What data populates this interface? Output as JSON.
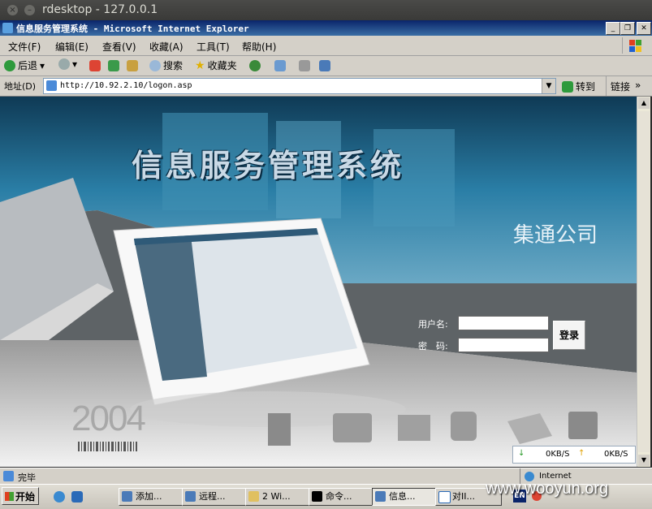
{
  "rdesktop": {
    "title": "rdesktop - 127.0.0.1",
    "close": "×",
    "minimize": "–"
  },
  "ie": {
    "title": "信息服务管理系统 - Microsoft Internet Explorer"
  },
  "menu": [
    "文件(F)",
    "编辑(E)",
    "查看(V)",
    "收藏(A)",
    "工具(T)",
    "帮助(H)"
  ],
  "toolbar": {
    "back": "后退",
    "search": "搜索",
    "favorites": "收藏夹"
  },
  "address": {
    "label": "地址(D)",
    "url": "http://10.92.2.10/logon.asp",
    "go": "转到",
    "links": "链接"
  },
  "page": {
    "heading": "信息服务管理系统",
    "company": "集通公司",
    "username_label": "用户名:",
    "password_label": "密　码:",
    "login_button": "登录",
    "year": "2004",
    "net_down": "0KB/S",
    "net_up": "0KB/S"
  },
  "status": {
    "text": "完毕",
    "zone": "Internet"
  },
  "taskbar": {
    "start": "开始",
    "tasks": [
      "添加...",
      "远程...",
      "2 Wi...",
      "命令...",
      "信息...",
      "对II..."
    ],
    "lang": "EN",
    "watermark": "www.wooyun.org"
  },
  "colors": {
    "ie_title": "#0a246a",
    "banner": "#1e5f80",
    "accent": "#c9d9e6"
  }
}
